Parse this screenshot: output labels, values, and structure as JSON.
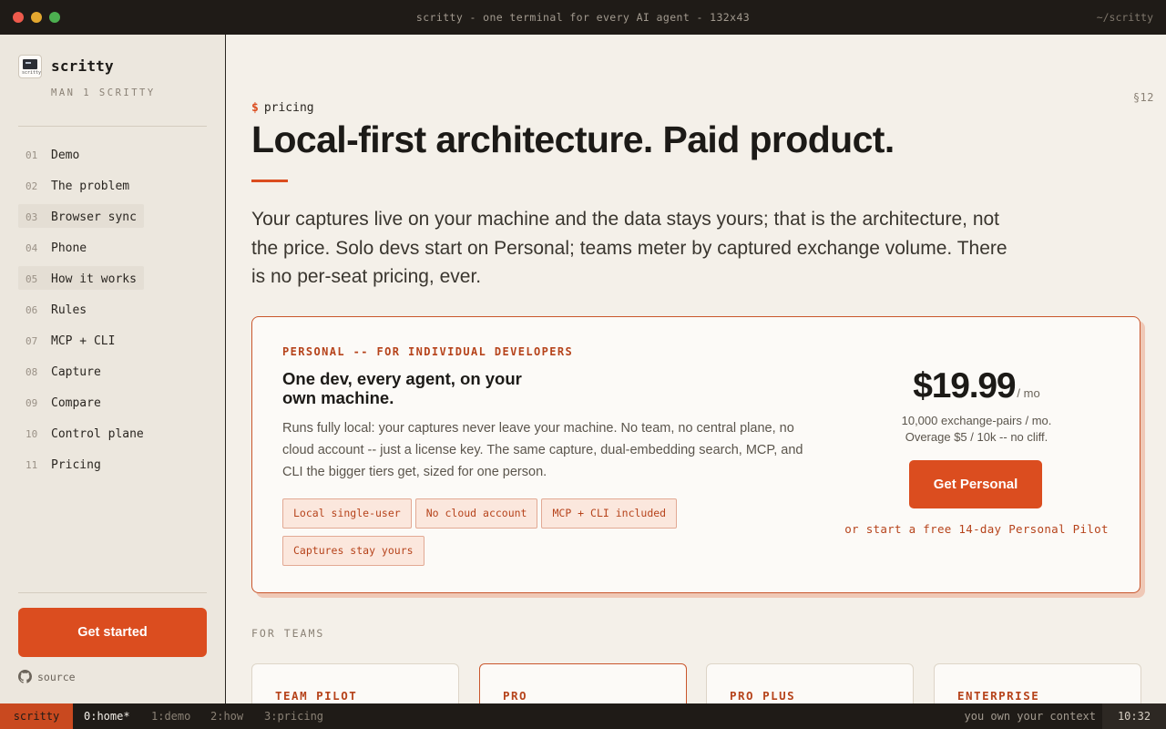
{
  "window": {
    "title": "scritty - one terminal for every AI agent - 132x43",
    "path": "~/scritty"
  },
  "sidebar": {
    "brand_name": "scritty",
    "brand_icon_caption": "scritty",
    "brand_sub": "MAN 1 SCRITTY",
    "items": [
      {
        "num": "01",
        "label": "Demo"
      },
      {
        "num": "02",
        "label": "The problem"
      },
      {
        "num": "03",
        "label": "Browser sync"
      },
      {
        "num": "04",
        "label": "Phone"
      },
      {
        "num": "05",
        "label": "How it works"
      },
      {
        "num": "06",
        "label": "Rules"
      },
      {
        "num": "07",
        "label": "MCP + CLI"
      },
      {
        "num": "08",
        "label": "Capture"
      },
      {
        "num": "09",
        "label": "Compare"
      },
      {
        "num": "10",
        "label": "Control plane"
      },
      {
        "num": "11",
        "label": "Pricing"
      }
    ],
    "cta_label": "Get started",
    "source_label": "source"
  },
  "main": {
    "section_number": "§12",
    "prompt_symbol": "$",
    "prompt_text": "pricing",
    "headline": "Local-first architecture. Paid product.",
    "lede": "Your captures live on your machine and the data stays yours; that is the architecture, not the price. Solo devs start on Personal; teams meter by captured exchange volume. There is no per-seat pricing, ever.",
    "personal_card": {
      "eyebrow": "PERSONAL -- FOR INDIVIDUAL DEVELOPERS",
      "title": "One dev, every agent, on your own machine.",
      "body": "Runs fully local: your captures never leave your machine. No team, no central plane, no cloud account -- just a license key. The same capture, dual-embedding search, MCP, and CLI the bigger tiers get, sized for one person.",
      "tags": [
        "Local single-user",
        "No cloud account",
        "MCP + CLI included",
        "Captures stay yours"
      ],
      "price": "$19.99",
      "price_period": "/ mo",
      "quota": "10,000 exchange-pairs / mo.",
      "overage": "Overage $5 / 10k -- no cliff.",
      "button_label": "Get Personal",
      "pilot_link": "or start a free 14-day Personal Pilot"
    },
    "teams_label": "FOR TEAMS",
    "team_tiers": [
      "TEAM PILOT",
      "PRO",
      "PRO PLUS",
      "ENTERPRISE"
    ]
  },
  "statusbar": {
    "session": "scritty",
    "windows": [
      "0:home*",
      "1:demo",
      "2:how",
      "3:pricing"
    ],
    "right_text": "you own your context",
    "clock": "10:32"
  },
  "colors": {
    "accent": "#db4d1f",
    "background": "#f4f0e9",
    "sidebar": "#ece7de",
    "chrome": "#1f1b17"
  },
  "icons": [
    "github-icon",
    "app-logo-icon"
  ]
}
